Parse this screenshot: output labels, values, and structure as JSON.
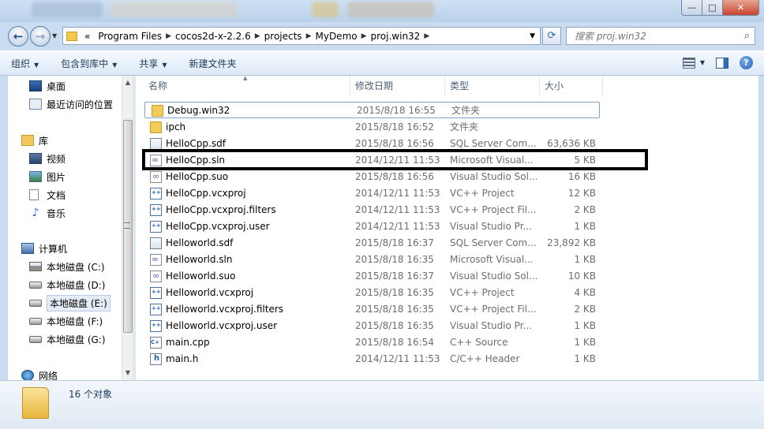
{
  "window": {
    "buttons": {
      "minimize": "—",
      "maximize": "□",
      "close": "✕"
    }
  },
  "address": {
    "recent_pages": "▼",
    "overflow": "«",
    "crumbs": [
      "Program Files",
      "cocos2d-x-2.2.6",
      "projects",
      "MyDemo",
      "proj.win32"
    ],
    "separator": "▶",
    "dropdown": "▼",
    "refresh": "⟳",
    "search_placeholder": "搜索 proj.win32",
    "search_icon": "⌕"
  },
  "toolbar": {
    "organize": "组织",
    "include_in_library": "包含到库中",
    "share": "共享",
    "new_folder": "新建文件夹",
    "help": "?",
    "caret": "▼"
  },
  "nav": {
    "items": [
      {
        "label": "桌面",
        "icon": "desktop-icon"
      },
      {
        "label": "最近访问的位置",
        "icon": "recent-places-icon"
      },
      {
        "label": "库",
        "icon": "library-icon"
      },
      {
        "label": "视频",
        "icon": "video-icon"
      },
      {
        "label": "图片",
        "icon": "pictures-icon"
      },
      {
        "label": "文档",
        "icon": "documents-icon"
      },
      {
        "label": "音乐",
        "icon": "music-icon"
      },
      {
        "label": "计算机",
        "icon": "computer-icon"
      },
      {
        "label": "本地磁盘 (C:)",
        "icon": "system-drive-icon"
      },
      {
        "label": "本地磁盘 (D:)",
        "icon": "drive-icon"
      },
      {
        "label": "本地磁盘 (E:)",
        "icon": "drive-icon"
      },
      {
        "label": "本地磁盘 (F:)",
        "icon": "drive-icon"
      },
      {
        "label": "本地磁盘 (G:)",
        "icon": "drive-icon"
      },
      {
        "label": "网络",
        "icon": "network-icon"
      }
    ],
    "selected": "本地磁盘 (E:)",
    "scroll_up": "▲",
    "scroll_down": "▼"
  },
  "columns": {
    "name": "名称",
    "modified": "修改日期",
    "type": "类型",
    "size": "大小"
  },
  "files": [
    {
      "name": "Debug.win32",
      "modified": "2015/8/18 16:55",
      "type": "文件夹",
      "size": "",
      "icon": "folder-icon"
    },
    {
      "name": "ipch",
      "modified": "2015/8/18 16:52",
      "type": "文件夹",
      "size": "",
      "icon": "folder-icon"
    },
    {
      "name": "HelloCpp.sdf",
      "modified": "2015/8/18 16:56",
      "type": "SQL Server Com...",
      "size": "63,636 KB",
      "icon": "sdf-file-icon"
    },
    {
      "name": "HelloCpp.sln",
      "modified": "2014/12/11 11:53",
      "type": "Microsoft Visual...",
      "size": "5 KB",
      "icon": "sln-file-icon"
    },
    {
      "name": "HelloCpp.suo",
      "modified": "2015/8/18 16:56",
      "type": "Visual Studio Sol...",
      "size": "16 KB",
      "icon": "suo-file-icon"
    },
    {
      "name": "HelloCpp.vcxproj",
      "modified": "2014/12/11 11:53",
      "type": "VC++ Project",
      "size": "12 KB",
      "icon": "vcxproj-file-icon"
    },
    {
      "name": "HelloCpp.vcxproj.filters",
      "modified": "2014/12/11 11:53",
      "type": "VC++ Project Fil...",
      "size": "2 KB",
      "icon": "vcxproj-file-icon"
    },
    {
      "name": "HelloCpp.vcxproj.user",
      "modified": "2014/12/11 11:53",
      "type": "Visual Studio Pr...",
      "size": "1 KB",
      "icon": "vcxproj-file-icon"
    },
    {
      "name": "Helloworld.sdf",
      "modified": "2015/8/18 16:37",
      "type": "SQL Server Com...",
      "size": "23,892 KB",
      "icon": "sdf-file-icon"
    },
    {
      "name": "Helloworld.sln",
      "modified": "2015/8/18 16:35",
      "type": "Microsoft Visual...",
      "size": "1 KB",
      "icon": "sln-file-icon"
    },
    {
      "name": "Helloworld.suo",
      "modified": "2015/8/18 16:37",
      "type": "Visual Studio Sol...",
      "size": "10 KB",
      "icon": "suo-file-icon"
    },
    {
      "name": "Helloworld.vcxproj",
      "modified": "2015/8/18 16:35",
      "type": "VC++ Project",
      "size": "4 KB",
      "icon": "vcxproj-file-icon"
    },
    {
      "name": "Helloworld.vcxproj.filters",
      "modified": "2015/8/18 16:35",
      "type": "VC++ Project Fil...",
      "size": "2 KB",
      "icon": "vcxproj-file-icon"
    },
    {
      "name": "Helloworld.vcxproj.user",
      "modified": "2015/8/18 16:35",
      "type": "Visual Studio Pr...",
      "size": "1 KB",
      "icon": "vcxproj-file-icon"
    },
    {
      "name": "main.cpp",
      "modified": "2015/8/18 16:54",
      "type": "C++ Source",
      "size": "1 KB",
      "icon": "cpp-file-icon"
    },
    {
      "name": "main.h",
      "modified": "2014/12/11 11:53",
      "type": "C/C++ Header",
      "size": "1 KB",
      "icon": "header-file-icon"
    }
  ],
  "status": {
    "item_count": "16 个对象"
  }
}
